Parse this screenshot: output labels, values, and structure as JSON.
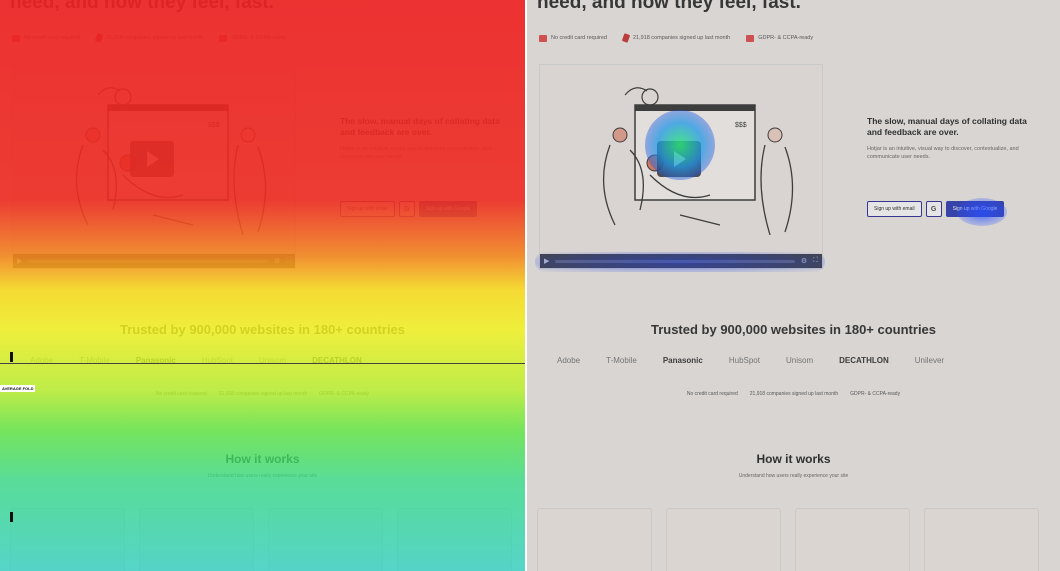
{
  "hero": {
    "title": "need, and how they feel, fast."
  },
  "badges": [
    "No credit card required",
    "21,918 companies signed up last month",
    "GDPR- & CCPA-ready"
  ],
  "intro": {
    "heading": "The slow, manual days of collating data and feedback are over.",
    "body": "Hotjar is an intuitive, visual way to discover, contextualize, and communicate user needs."
  },
  "cta": {
    "email_label": "Sign up with email",
    "google_glyph": "G",
    "google_label": "Sign up with Google"
  },
  "trusted": "Trusted by 900,000 websites in 180+ countries",
  "logos": [
    "Adobe",
    "T-Mobile",
    "Panasonic",
    "HubSpot",
    "Unisom",
    "DECATHLON",
    "Unilever"
  ],
  "checks": [
    "No credit card required",
    "21,918 companies signed up last month",
    "GDPR- & CCPA-ready"
  ],
  "how": {
    "title": "How it works",
    "subtitle": "Understand how users really experience your site"
  },
  "fold_label": "AVERAGE FOLD",
  "colors": {
    "cta_blue": "#2d3ab8",
    "badge_red": "#e44a4a"
  }
}
